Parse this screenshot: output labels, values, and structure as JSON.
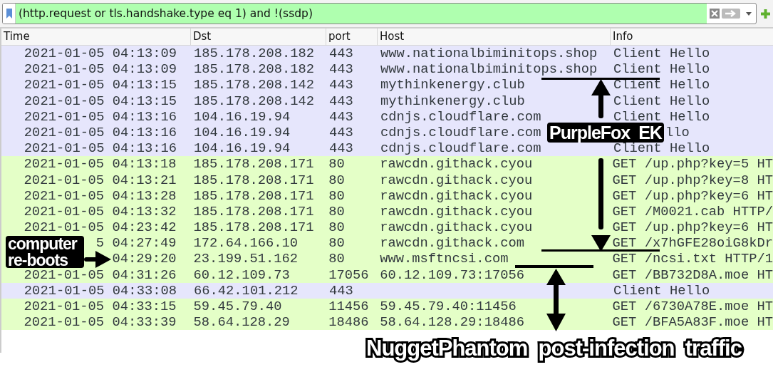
{
  "filter": {
    "value": "(http.request or tls.handshake.type eq 1) and !(ssdp)"
  },
  "table": {
    "columns": [
      "Time",
      "Dst",
      "port",
      "Host",
      "Info"
    ],
    "rows": [
      {
        "kind": "tls",
        "time": "2021-01-05 04:13:09",
        "dst": "185.178.208.182",
        "port": "443",
        "host": "www.nationalbiminitops.shop",
        "info": "Client Hello"
      },
      {
        "kind": "tls",
        "time": "2021-01-05 04:13:09",
        "dst": "185.178.208.182",
        "port": "443",
        "host": "www.nationalbiminitops.shop",
        "info": "Client Hello"
      },
      {
        "kind": "tls",
        "time": "2021-01-05 04:13:15",
        "dst": "185.178.208.142",
        "port": "443",
        "host": "mythinkenergy.club",
        "info": "Client Hello"
      },
      {
        "kind": "tls",
        "time": "2021-01-05 04:13:15",
        "dst": "185.178.208.142",
        "port": "443",
        "host": "mythinkenergy.club",
        "info": "Client Hello"
      },
      {
        "kind": "tls",
        "time": "2021-01-05 04:13:16",
        "dst": "104.16.19.94",
        "port": "443",
        "host": "cdnjs.cloudflare.com",
        "info": "Client Hello"
      },
      {
        "kind": "tls",
        "time": "2021-01-05 04:13:16",
        "dst": "104.16.19.94",
        "port": "443",
        "host": "cdnjs.cloudflare.com",
        "info": "llo"
      },
      {
        "kind": "tls",
        "time": "2021-01-05 04:13:16",
        "dst": "104.16.19.94",
        "port": "443",
        "host": "cdnjs.cloudflare.com",
        "info": "Client Hello"
      },
      {
        "kind": "http",
        "time": "2021-01-05 04:13:18",
        "dst": "185.178.208.171",
        "port": "80",
        "host": "rawcdn.githack.cyou",
        "info": "GET /up.php?key=5 HT"
      },
      {
        "kind": "http",
        "time": "2021-01-05 04:13:21",
        "dst": "185.178.208.171",
        "port": "80",
        "host": "rawcdn.githack.cyou",
        "info": "GET /up.php?key=8 HT"
      },
      {
        "kind": "http",
        "time": "2021-01-05 04:13:28",
        "dst": "185.178.208.171",
        "port": "80",
        "host": "rawcdn.githack.cyou",
        "info": "GET /up.php?key=6 HT"
      },
      {
        "kind": "http",
        "time": "2021-01-05 04:13:32",
        "dst": "185.178.208.171",
        "port": "80",
        "host": "rawcdn.githack.cyou",
        "info": "GET /M0021.cab HTTP/"
      },
      {
        "kind": "http",
        "time": "2021-01-05 04:23:42",
        "dst": "185.178.208.171",
        "port": "80",
        "host": "rawcdn.githack.cyou",
        "info": "GET /up.php?key=6 HT"
      },
      {
        "kind": "http",
        "time": "5 04:27:49",
        "dst": "172.64.166.10",
        "port": "80",
        "host": "rawcdn.githack.com",
        "info": "GET /x7hGFE28oiG8kDr"
      },
      {
        "kind": "http",
        "time": "04:29:20",
        "dst": "23.199.51.162",
        "port": "80",
        "host": "www.msftncsi.com",
        "info": "GET /ncsi.txt HTTP/1"
      },
      {
        "kind": "http",
        "time": "2021-01-05 04:31:26",
        "dst": "60.12.109.73",
        "port": "17056",
        "host": "60.12.109.73:17056",
        "info": "GET /BB732D8A.moe HT"
      },
      {
        "kind": "tls",
        "time": "2021-01-05 04:33:08",
        "dst": "66.42.101.212",
        "port": "443",
        "info": "Client Hello"
      },
      {
        "kind": "http",
        "time": "2021-01-05 04:33:15",
        "dst": "59.45.79.40",
        "port": "11456",
        "host": "59.45.79.40:11456",
        "info": "GET /6730A78E.moe HT"
      },
      {
        "kind": "http",
        "time": "2021-01-05 04:33:39",
        "dst": "58.64.128.29",
        "port": "18486",
        "host": "58.64.128.29:18486",
        "info": "GET /BFA5A83F.moe HT"
      }
    ]
  },
  "annotations": [
    {
      "text": "PurpleFox  EK"
    },
    {
      "text": "computer re-boots"
    },
    {
      "text": "NuggetPhantom  post-infection  traffic"
    }
  ]
}
